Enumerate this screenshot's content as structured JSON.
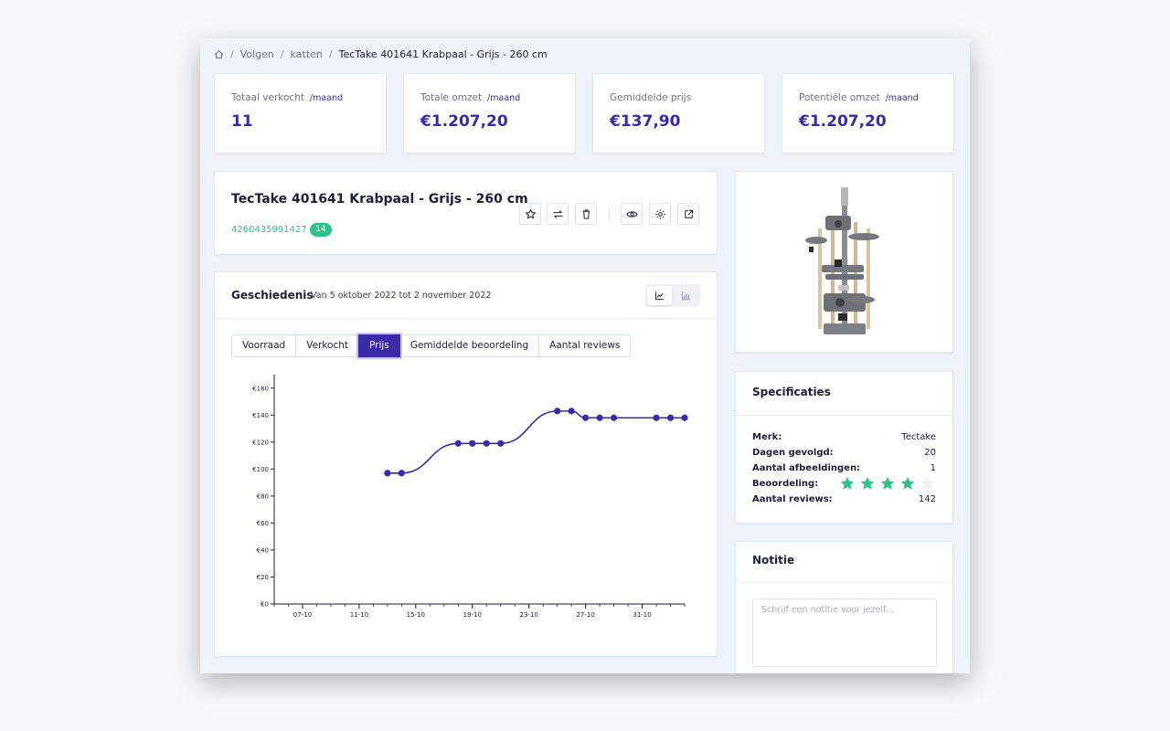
{
  "breadcrumb": {
    "home_icon": "home-icon",
    "items": [
      "Volgen",
      "katten"
    ],
    "current": "TecTake 401641 Krabpaal - Grijs - 260 cm",
    "separator": "/"
  },
  "stats": [
    {
      "label": "Totaal verkocht",
      "period": "/maand",
      "value": "11"
    },
    {
      "label": "Totale omzet",
      "period": "/maand",
      "value": "€1.207,20"
    },
    {
      "label": "Gemiddelde prijs",
      "period": "",
      "value": "€137,90"
    },
    {
      "label": "Potentiële omzet",
      "period": "/maand",
      "value": "€1.207,20"
    }
  ],
  "product": {
    "title": "TecTake 401641 Krabpaal - Grijs - 260 cm",
    "ean": "4260435991427",
    "ean_badge": "14",
    "actions": [
      "star-icon",
      "compare-arrows-icon",
      "trash-icon",
      "eye-icon",
      "settings-icon",
      "external-link-icon"
    ]
  },
  "history": {
    "title": "Geschiedenis",
    "range": "Van 5 oktober 2022 tot 2 november 2022",
    "views": [
      "line-chart-icon",
      "bar-chart-icon"
    ],
    "active_view": "line-chart-icon",
    "tabs": [
      "Voorraad",
      "Verkocht",
      "Prijs",
      "Gemiddelde beoordeling",
      "Aantal reviews"
    ],
    "active_tab": "Prijs"
  },
  "chart_data": {
    "type": "line",
    "title": "",
    "xlabel": "",
    "ylabel": "",
    "series": [
      {
        "x": [
          "2022-10-13",
          "2022-10-14",
          "2022-10-18",
          "2022-10-19",
          "2022-10-20",
          "2022-10-21",
          "2022-10-25",
          "2022-10-26",
          "2022-10-27",
          "2022-10-28",
          "2022-10-29",
          "2022-11-01",
          "2022-11-02",
          "2022-11-03"
        ],
        "values": [
          97,
          97,
          119,
          119,
          119,
          119,
          143,
          143,
          138,
          138,
          138,
          138,
          138,
          138
        ]
      }
    ],
    "x_range": [
      "2022-10-05",
      "2022-11-03"
    ],
    "x_ticks": [
      "07-10",
      "11-10",
      "15-10",
      "19-10",
      "23-10",
      "27-10",
      "31-10"
    ],
    "y_ticks": [
      "€0",
      "€20",
      "€40",
      "€60",
      "€80",
      "€100",
      "€120",
      "€140",
      "€160"
    ],
    "ylim": [
      0,
      170
    ],
    "grid": false,
    "color": "#3a2aa8"
  },
  "specs": {
    "title": "Specificaties",
    "rows": [
      {
        "label": "Merk:",
        "value": "Tectake"
      },
      {
        "label": "Dagen gevolgd:",
        "value": "20"
      },
      {
        "label": "Aantal afbeeldingen:",
        "value": "1"
      },
      {
        "label": "Beoordeling:",
        "rating": 4,
        "max": 5
      },
      {
        "label": "Aantal reviews:",
        "value": "142"
      }
    ],
    "star_color": "#2cc28a",
    "star_empty_color": "#eef2f6"
  },
  "note": {
    "title": "Notitie",
    "placeholder": "Schrijf een notitie voor jezelf..."
  },
  "colors": {
    "accent": "#3a2aa8",
    "success": "#2cc28a",
    "background": "#edf3f8"
  }
}
